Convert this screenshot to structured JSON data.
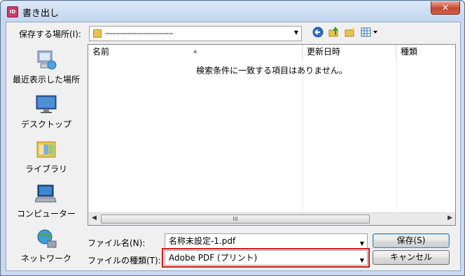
{
  "window": {
    "title": "書き出し",
    "app_icon_text": "ID",
    "close_glyph": "✕"
  },
  "location": {
    "label": "保存する場所(I):",
    "value": "----------------------------"
  },
  "toolbar": {
    "icons": [
      "back-icon",
      "up-folder-icon",
      "new-folder-icon",
      "view-menu-icon"
    ]
  },
  "places": [
    {
      "name": "recent",
      "label": "最近表示した場所",
      "icon": "recent-places-icon"
    },
    {
      "name": "desktop",
      "label": "デスクトップ",
      "icon": "desktop-icon"
    },
    {
      "name": "libraries",
      "label": "ライブラリ",
      "icon": "libraries-icon"
    },
    {
      "name": "computer",
      "label": "コンピューター",
      "icon": "computer-icon"
    },
    {
      "name": "network",
      "label": "ネットワーク",
      "icon": "network-icon"
    }
  ],
  "file_list": {
    "columns": [
      "名前",
      "更新日時",
      "種類"
    ],
    "empty_message": "検索条件に一致する項目はありません。",
    "scroll_grip": "III"
  },
  "filename": {
    "label": "ファイル名(N):",
    "value": "名称未設定-1.pdf"
  },
  "filetype": {
    "label": "ファイルの種類(T):",
    "value": "Adobe PDF (プリント)"
  },
  "buttons": {
    "save": "保存(S)",
    "cancel": "キャンセル"
  },
  "colors": {
    "highlight": "#d01a1a",
    "titlebar": "#c3d6ee"
  }
}
